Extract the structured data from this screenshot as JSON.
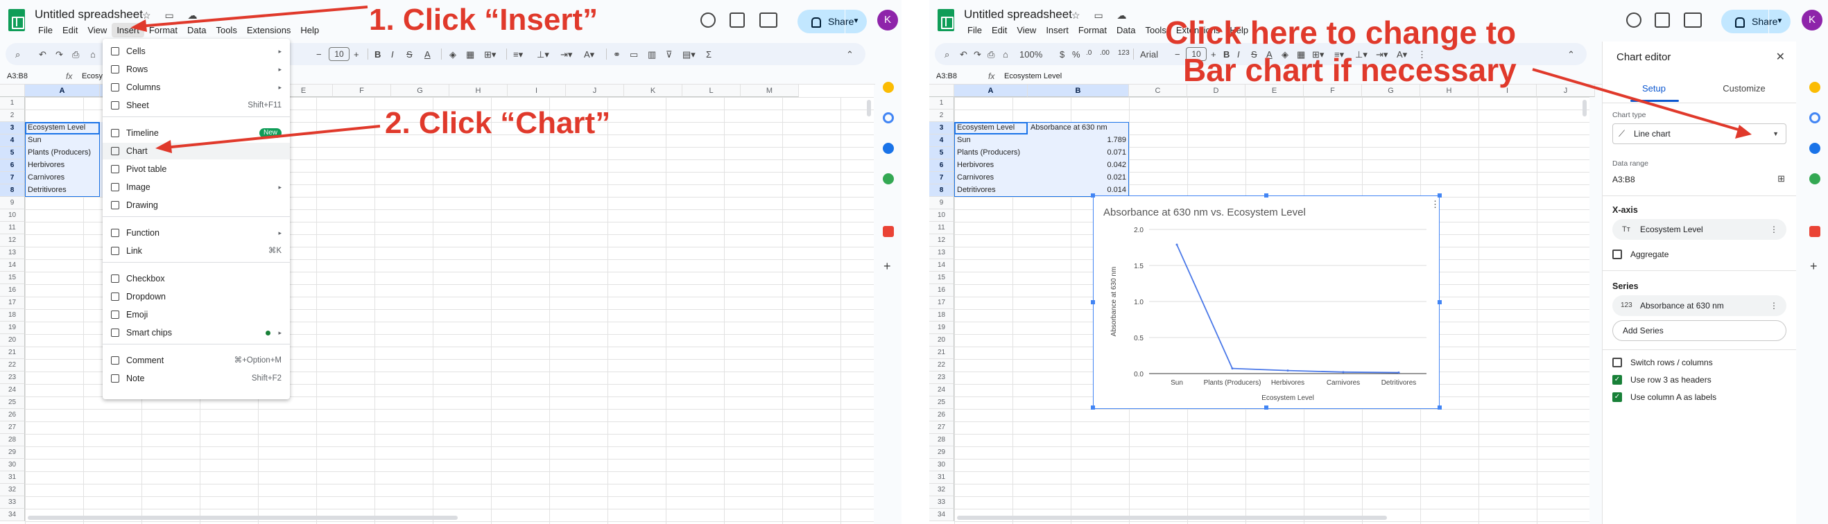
{
  "left": {
    "doc_title": "Untitled spreadsheet",
    "menus": [
      "File",
      "Edit",
      "View",
      "Insert",
      "Format",
      "Data",
      "Tools",
      "Extensions",
      "Help"
    ],
    "share_label": "Share",
    "avatar_initial": "K",
    "font_size": "10",
    "name_box": "A3:B8",
    "formula_value": "Ecosys",
    "columns": [
      "A",
      "B",
      "C",
      "D",
      "E",
      "F",
      "G",
      "H",
      "I",
      "J",
      "K",
      "L",
      "M"
    ],
    "insert_menu": {
      "items": [
        {
          "label": "Cells",
          "shortcut": "",
          "arrow": "▸"
        },
        {
          "label": "Rows",
          "shortcut": "",
          "arrow": "▸"
        },
        {
          "label": "Columns",
          "shortcut": "",
          "arrow": "▸"
        },
        {
          "label": "Sheet",
          "shortcut": "Shift+F11",
          "arrow": ""
        },
        {
          "label": "Timeline",
          "shortcut": "",
          "arrow": "",
          "badge": "New"
        },
        {
          "label": "Chart",
          "shortcut": "",
          "arrow": ""
        },
        {
          "label": "Pivot table",
          "shortcut": "",
          "arrow": ""
        },
        {
          "label": "Image",
          "shortcut": "",
          "arrow": "▸"
        },
        {
          "label": "Drawing",
          "shortcut": "",
          "arrow": ""
        },
        {
          "label": "Function",
          "shortcut": "",
          "arrow": "▸"
        },
        {
          "label": "Link",
          "shortcut": "⌘K",
          "arrow": ""
        },
        {
          "label": "Checkbox",
          "shortcut": "",
          "arrow": ""
        },
        {
          "label": "Dropdown",
          "shortcut": "",
          "arrow": ""
        },
        {
          "label": "Emoji",
          "shortcut": "",
          "arrow": ""
        },
        {
          "label": "Smart chips",
          "shortcut": "",
          "arrow": "▸"
        },
        {
          "label": "Comment",
          "shortcut": "⌘+Option+M",
          "arrow": ""
        },
        {
          "label": "Note",
          "shortcut": "Shift+F2",
          "arrow": ""
        }
      ]
    },
    "annotations": [
      "1. Click “Insert”",
      "2. Click “Chart”"
    ]
  },
  "right": {
    "doc_title": "Untitled spreadsheet",
    "menus": [
      "File",
      "Edit",
      "View",
      "Insert",
      "Format",
      "Data",
      "Tools",
      "Extensions",
      "Help"
    ],
    "share_label": "Share",
    "avatar_initial": "K",
    "zoom": "100%",
    "currency": "$",
    "percent": "%",
    "decimals": ".0",
    "decimals_more": ".00",
    "number_fmt": "123",
    "font_name": "Arial",
    "font_size": "10",
    "name_box": "A3:B8",
    "formula_value": "Ecosystem Level",
    "columns": [
      "A",
      "B",
      "C",
      "D",
      "E",
      "F",
      "G",
      "H",
      "I",
      "J"
    ],
    "annotation_line1": "Click here to change to",
    "annotation_line2": "Bar chart if necessary",
    "chart_editor": {
      "title": "Chart editor",
      "tab_setup": "Setup",
      "tab_customize": "Customize",
      "chart_type_label": "Chart type",
      "chart_type_value": "Line chart",
      "data_range_label": "Data range",
      "data_range_value": "A3:B8",
      "xaxis_label": "X-axis",
      "xaxis_value": "Ecosystem Level",
      "aggregate": "Aggregate",
      "series_label": "Series",
      "series_value": "Absorbance at 630 nm",
      "series_icon_text": "123",
      "add_series": "Add Series",
      "switch_rows": "Switch rows / columns",
      "use_row3": "Use row 3 as headers",
      "use_colA": "Use column A as labels"
    }
  },
  "table": {
    "header": [
      "Ecosystem Level",
      "Absorbance at 630 nm"
    ],
    "rows": [
      [
        "Sun",
        "1.789"
      ],
      [
        "Plants (Producers)",
        "0.071"
      ],
      [
        "Herbivores",
        "0.042"
      ],
      [
        "Carnivores",
        "0.021"
      ],
      [
        "Detritivores",
        "0.014"
      ]
    ]
  },
  "chart_data": {
    "type": "line",
    "title": "Absorbance at 630 nm vs. Ecosystem Level",
    "xlabel": "Ecosystem Level",
    "ylabel": "Absorbance at 630 nm",
    "categories": [
      "Sun",
      "Plants (Producers)",
      "Herbivores",
      "Carnivores",
      "Detritivores"
    ],
    "values": [
      1.789,
      0.071,
      0.042,
      0.021,
      0.014
    ],
    "ylim": [
      0,
      2.0
    ],
    "yticks": [
      "0.0",
      "0.5",
      "1.0",
      "1.5",
      "2.0"
    ],
    "color": "#4a78e8"
  },
  "colors": {
    "annotation": "#e0392b",
    "share_bg": "#c2e7ff",
    "avatar": "#8e24aa",
    "selection": "#d3e3fd"
  }
}
